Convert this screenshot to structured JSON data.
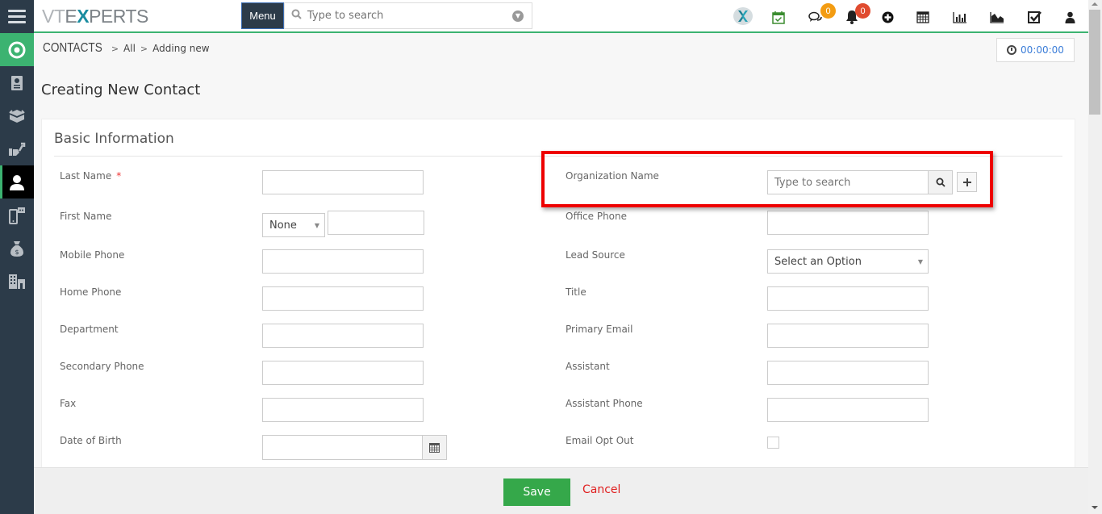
{
  "header": {
    "logo_text_vt": "VT",
    "logo_text_e": "E",
    "logo_text_x": "X",
    "logo_text_rest": "PERTS",
    "menu_label": "Menu",
    "search_placeholder": "Type to search",
    "icons": [
      {
        "name": "vtexperts-x-icon"
      },
      {
        "name": "task-calendar-icon"
      },
      {
        "name": "comments-icon",
        "badge": "0",
        "badge_color": "#f39c12"
      },
      {
        "name": "notifications-bell-icon",
        "badge": "0",
        "badge_color": "#e04b2f"
      },
      {
        "name": "add-circle-icon"
      },
      {
        "name": "calendar-icon"
      },
      {
        "name": "reports-bar-chart-icon"
      },
      {
        "name": "area-chart-icon"
      },
      {
        "name": "tasks-checkbox-icon"
      },
      {
        "name": "user-profile-icon"
      }
    ]
  },
  "sidebar": {
    "items": [
      {
        "name": "home",
        "icon": "target-icon"
      },
      {
        "name": "contacts-book",
        "icon": "address-book-icon"
      },
      {
        "name": "products",
        "icon": "box-icon"
      },
      {
        "name": "support",
        "icon": "hand-wrench-icon"
      },
      {
        "name": "contacts",
        "icon": "user-icon",
        "active": true
      },
      {
        "name": "mobile",
        "icon": "mobile-chat-icon"
      },
      {
        "name": "sales",
        "icon": "money-bag-icon"
      },
      {
        "name": "organizations",
        "icon": "building-icon"
      }
    ]
  },
  "breadcrumb": {
    "module": "CONTACTS",
    "filter": "All",
    "action": "Adding new"
  },
  "timer": "00:00:00",
  "page_title": "Creating New Contact",
  "section_title": "Basic Information",
  "form": {
    "left": [
      {
        "label": "Last Name",
        "required": true,
        "value": ""
      },
      {
        "label": "First Name",
        "salutation": "None",
        "value": ""
      },
      {
        "label": "Mobile Phone",
        "value": ""
      },
      {
        "label": "Home Phone",
        "value": ""
      },
      {
        "label": "Department",
        "value": ""
      },
      {
        "label": "Secondary Phone",
        "value": ""
      },
      {
        "label": "Fax",
        "value": ""
      },
      {
        "label": "Date of Birth",
        "value": ""
      }
    ],
    "right": [
      {
        "label": "Organization Name",
        "placeholder": "Type to search",
        "value": ""
      },
      {
        "label": "Office Phone",
        "value": ""
      },
      {
        "label": "Lead Source",
        "selected": "Select an Option"
      },
      {
        "label": "Title",
        "value": ""
      },
      {
        "label": "Primary Email",
        "value": ""
      },
      {
        "label": "Assistant",
        "value": ""
      },
      {
        "label": "Assistant Phone",
        "value": ""
      },
      {
        "label": "Email Opt Out",
        "checked": false
      }
    ]
  },
  "footer": {
    "save_label": "Save",
    "cancel_label": "Cancel"
  },
  "colors": {
    "accent_green": "#3cb371",
    "sidebar_bg": "#2c3b49",
    "save_green": "#35a84a",
    "cancel_red": "#e01f1f",
    "highlight_red": "#e00000",
    "timer_blue": "#3b7dd8"
  }
}
